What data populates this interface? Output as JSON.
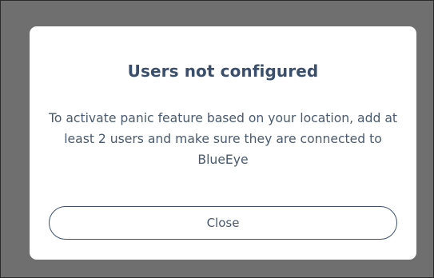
{
  "dialog": {
    "title": "Users not configured",
    "message": "To activate panic feature based on your location, add at least 2 users and make sure they are connected to BlueEye",
    "close_label": "Close"
  },
  "colors": {
    "overlay": "#6f6f6f",
    "dialog_background": "#ffffff",
    "title": "#3a4f6d",
    "text": "#4a5a70",
    "button_border": "#3d5170"
  }
}
